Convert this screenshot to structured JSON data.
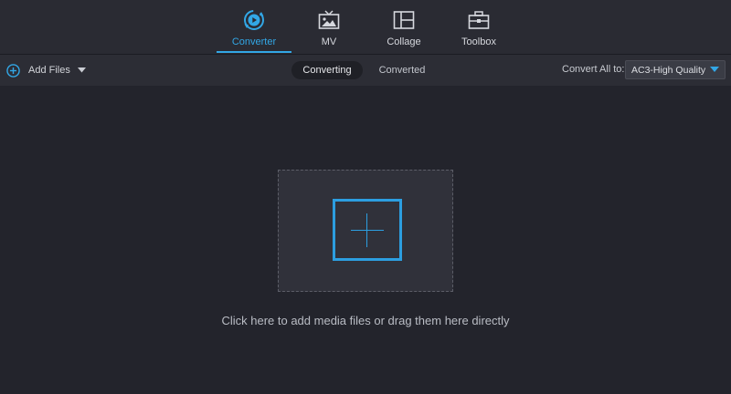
{
  "nav": {
    "items": [
      {
        "id": "converter",
        "label": "Converter",
        "icon": "converter-icon",
        "active": true
      },
      {
        "id": "mv",
        "label": "MV",
        "icon": "tv-icon",
        "active": false
      },
      {
        "id": "collage",
        "label": "Collage",
        "icon": "collage-icon",
        "active": false
      },
      {
        "id": "toolbox",
        "label": "Toolbox",
        "icon": "toolbox-icon",
        "active": false
      }
    ]
  },
  "toolbar": {
    "add_files_label": "Add Files",
    "tabs": [
      {
        "label": "Converting",
        "active": true
      },
      {
        "label": "Converted",
        "active": false
      }
    ],
    "convert_all_label": "Convert All to:",
    "format_value": "AC3-High Quality"
  },
  "dropzone": {
    "hint": "Click here to add media files or drag them here directly"
  },
  "colors": {
    "accent": "#32a7e6",
    "background": "#23242c",
    "topbar": "#2a2b33"
  }
}
